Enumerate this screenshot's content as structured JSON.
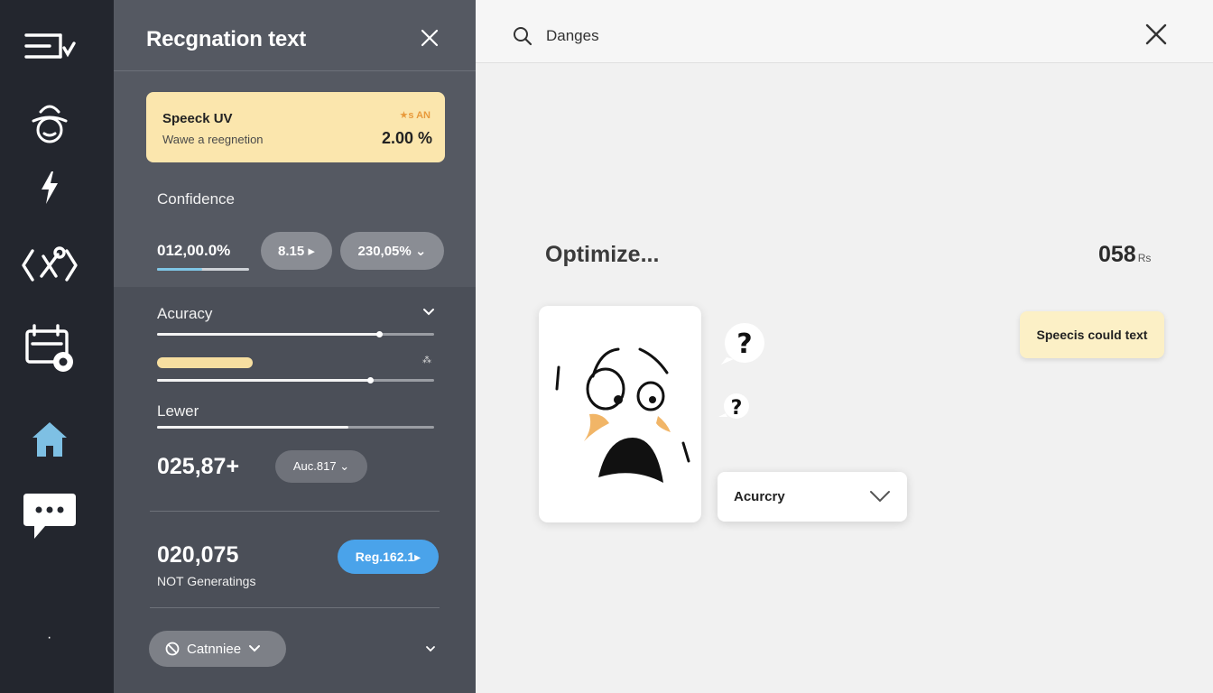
{
  "sidebar": {
    "icons": [
      "menu-check-icon",
      "user-hat-icon",
      "lightning-icon",
      "code-tools-icon",
      "calendar-settings-icon",
      "home-icon",
      "chat-icon"
    ],
    "dot": "·"
  },
  "panel": {
    "title": "Recgnation text",
    "speech_card": {
      "title": "Speeck UV",
      "subtitle": "Wawe a reegnetion",
      "badge": "★s AN",
      "percent": "2.00 %"
    },
    "confidence": {
      "label": "Confidence",
      "value": "012,00.0%",
      "pill1": "8.15 ▸",
      "pill2": "230,05% ⌄"
    },
    "accuracy": {
      "label": "Acuracy",
      "slider1_level": 0.8,
      "slider2_level": 0.77,
      "small_mark": "⁂"
    },
    "lewer": {
      "label": "Lewer",
      "value": "025,87+",
      "pill": "Auc.817 ⌄",
      "slider_level": 0.69
    },
    "gen": {
      "value": "020,075",
      "label": "NOT Generatings",
      "pill": "Reg.162.1▸"
    },
    "combine": {
      "label": "Catnniee"
    }
  },
  "main": {
    "search": {
      "value": "Danges"
    },
    "optimize": "Optimize...",
    "count": "058",
    "count_unit": "Rs",
    "tooltip": "Speecis could text",
    "dropdown": "Acurcry"
  },
  "colors": {
    "rail": "#23262e",
    "panel": "#4b4f58",
    "card_yellow": "#fbe6ad",
    "blue": "#4aa3ea",
    "home_icon": "#7ec0e4"
  }
}
